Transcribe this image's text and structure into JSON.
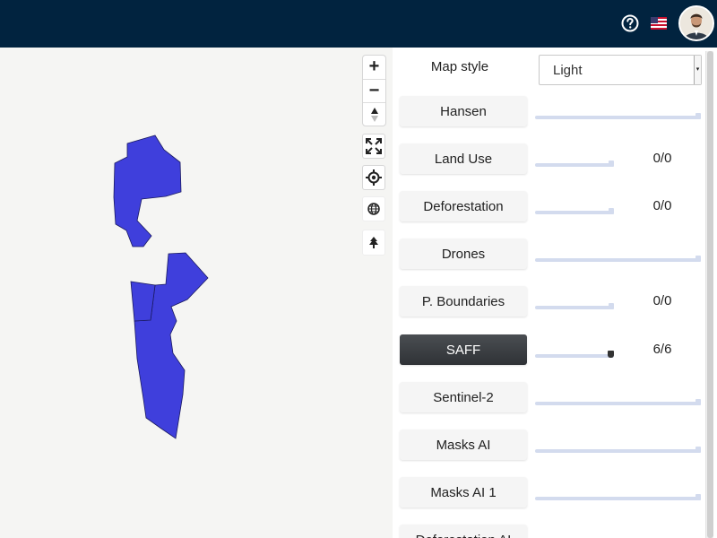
{
  "header": {
    "help_icon": "question-circle-icon",
    "language_flag": "us-flag-icon",
    "avatar": "user-avatar"
  },
  "map": {
    "controls": {
      "zoom_in": "+",
      "zoom_out": "−",
      "compass": "compass-icon",
      "fullscreen": "fullscreen-icon",
      "locate": "crosshair-icon",
      "globe": "globe-icon",
      "forest": "tree-icon"
    },
    "polygon_color": "#3f3fdc"
  },
  "panel": {
    "map_style_label": "Map style",
    "map_style_value": "Light",
    "layers": [
      {
        "label": "Hansen",
        "count": "",
        "active": false
      },
      {
        "label": "Land Use",
        "count": "0/0",
        "active": false
      },
      {
        "label": "Deforestation",
        "count": "0/0",
        "active": false
      },
      {
        "label": "Drones",
        "count": "",
        "active": false
      },
      {
        "label": "P. Boundaries",
        "count": "0/0",
        "active": false
      },
      {
        "label": "SAFF",
        "count": "6/6",
        "active": true
      },
      {
        "label": "Sentinel-2",
        "count": "",
        "active": false
      },
      {
        "label": "Masks AI",
        "count": "",
        "active": false
      },
      {
        "label": "Masks AI 1",
        "count": "",
        "active": false
      },
      {
        "label": "Deforestation AI",
        "count": "",
        "active": false
      }
    ]
  }
}
